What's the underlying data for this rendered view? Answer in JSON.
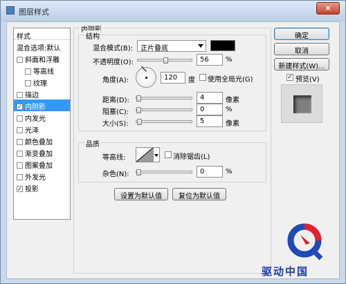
{
  "window": {
    "title": "图层样式",
    "close_glyph": "✕"
  },
  "style_list": {
    "header": "样式",
    "items": [
      {
        "label": "混合选项:默认",
        "checkbox": false,
        "checked": false
      },
      {
        "label": "斜面和浮雕",
        "checkbox": true,
        "checked": false
      },
      {
        "label": "等高线",
        "checkbox": true,
        "checked": false,
        "indent": true
      },
      {
        "label": "纹理",
        "checkbox": true,
        "checked": false,
        "indent": true
      },
      {
        "label": "描边",
        "checkbox": true,
        "checked": false
      },
      {
        "label": "内阴影",
        "checkbox": true,
        "checked": true,
        "selected": true
      },
      {
        "label": "内发光",
        "checkbox": true,
        "checked": false
      },
      {
        "label": "光泽",
        "checkbox": true,
        "checked": false
      },
      {
        "label": "颜色叠加",
        "checkbox": true,
        "checked": false
      },
      {
        "label": "渐变叠加",
        "checkbox": true,
        "checked": false
      },
      {
        "label": "图案叠加",
        "checkbox": true,
        "checked": false
      },
      {
        "label": "外发光",
        "checkbox": true,
        "checked": false
      },
      {
        "label": "投影",
        "checkbox": true,
        "checked": true
      }
    ]
  },
  "inner_shadow": {
    "title": "内阴影",
    "structure": {
      "title": "结构",
      "blend_mode_label": "混合模式(B):",
      "blend_mode_value": "正片叠底",
      "blend_color": "#000000",
      "opacity_label": "不透明度(O):",
      "opacity_value": "56",
      "opacity_unit": "%",
      "angle_label": "角度(A):",
      "angle_value": "120",
      "angle_unit": "度",
      "global_light_label": "使用全局光(G)",
      "global_light_checked": false,
      "distance_label": "距离(D):",
      "distance_value": "4",
      "distance_unit": "像素",
      "choke_label": "阻塞(C):",
      "choke_value": "0",
      "choke_unit": "%",
      "size_label": "大小(S):",
      "size_value": "5",
      "size_unit": "像素"
    },
    "quality": {
      "title": "品质",
      "contour_label": "等高线:",
      "anti_alias_label": "消除锯齿(L)",
      "anti_alias_checked": false,
      "noise_label": "杂色(N):",
      "noise_value": "0",
      "noise_unit": "%"
    },
    "set_default_button": "设置为默认值",
    "reset_default_button": "复位为默认值"
  },
  "buttons": {
    "ok": "确定",
    "cancel": "取消",
    "new_style": "新建样式(W)...",
    "preview_label": "预览(V)",
    "preview_checked": true
  },
  "watermark": {
    "text": "驱动中国"
  }
}
